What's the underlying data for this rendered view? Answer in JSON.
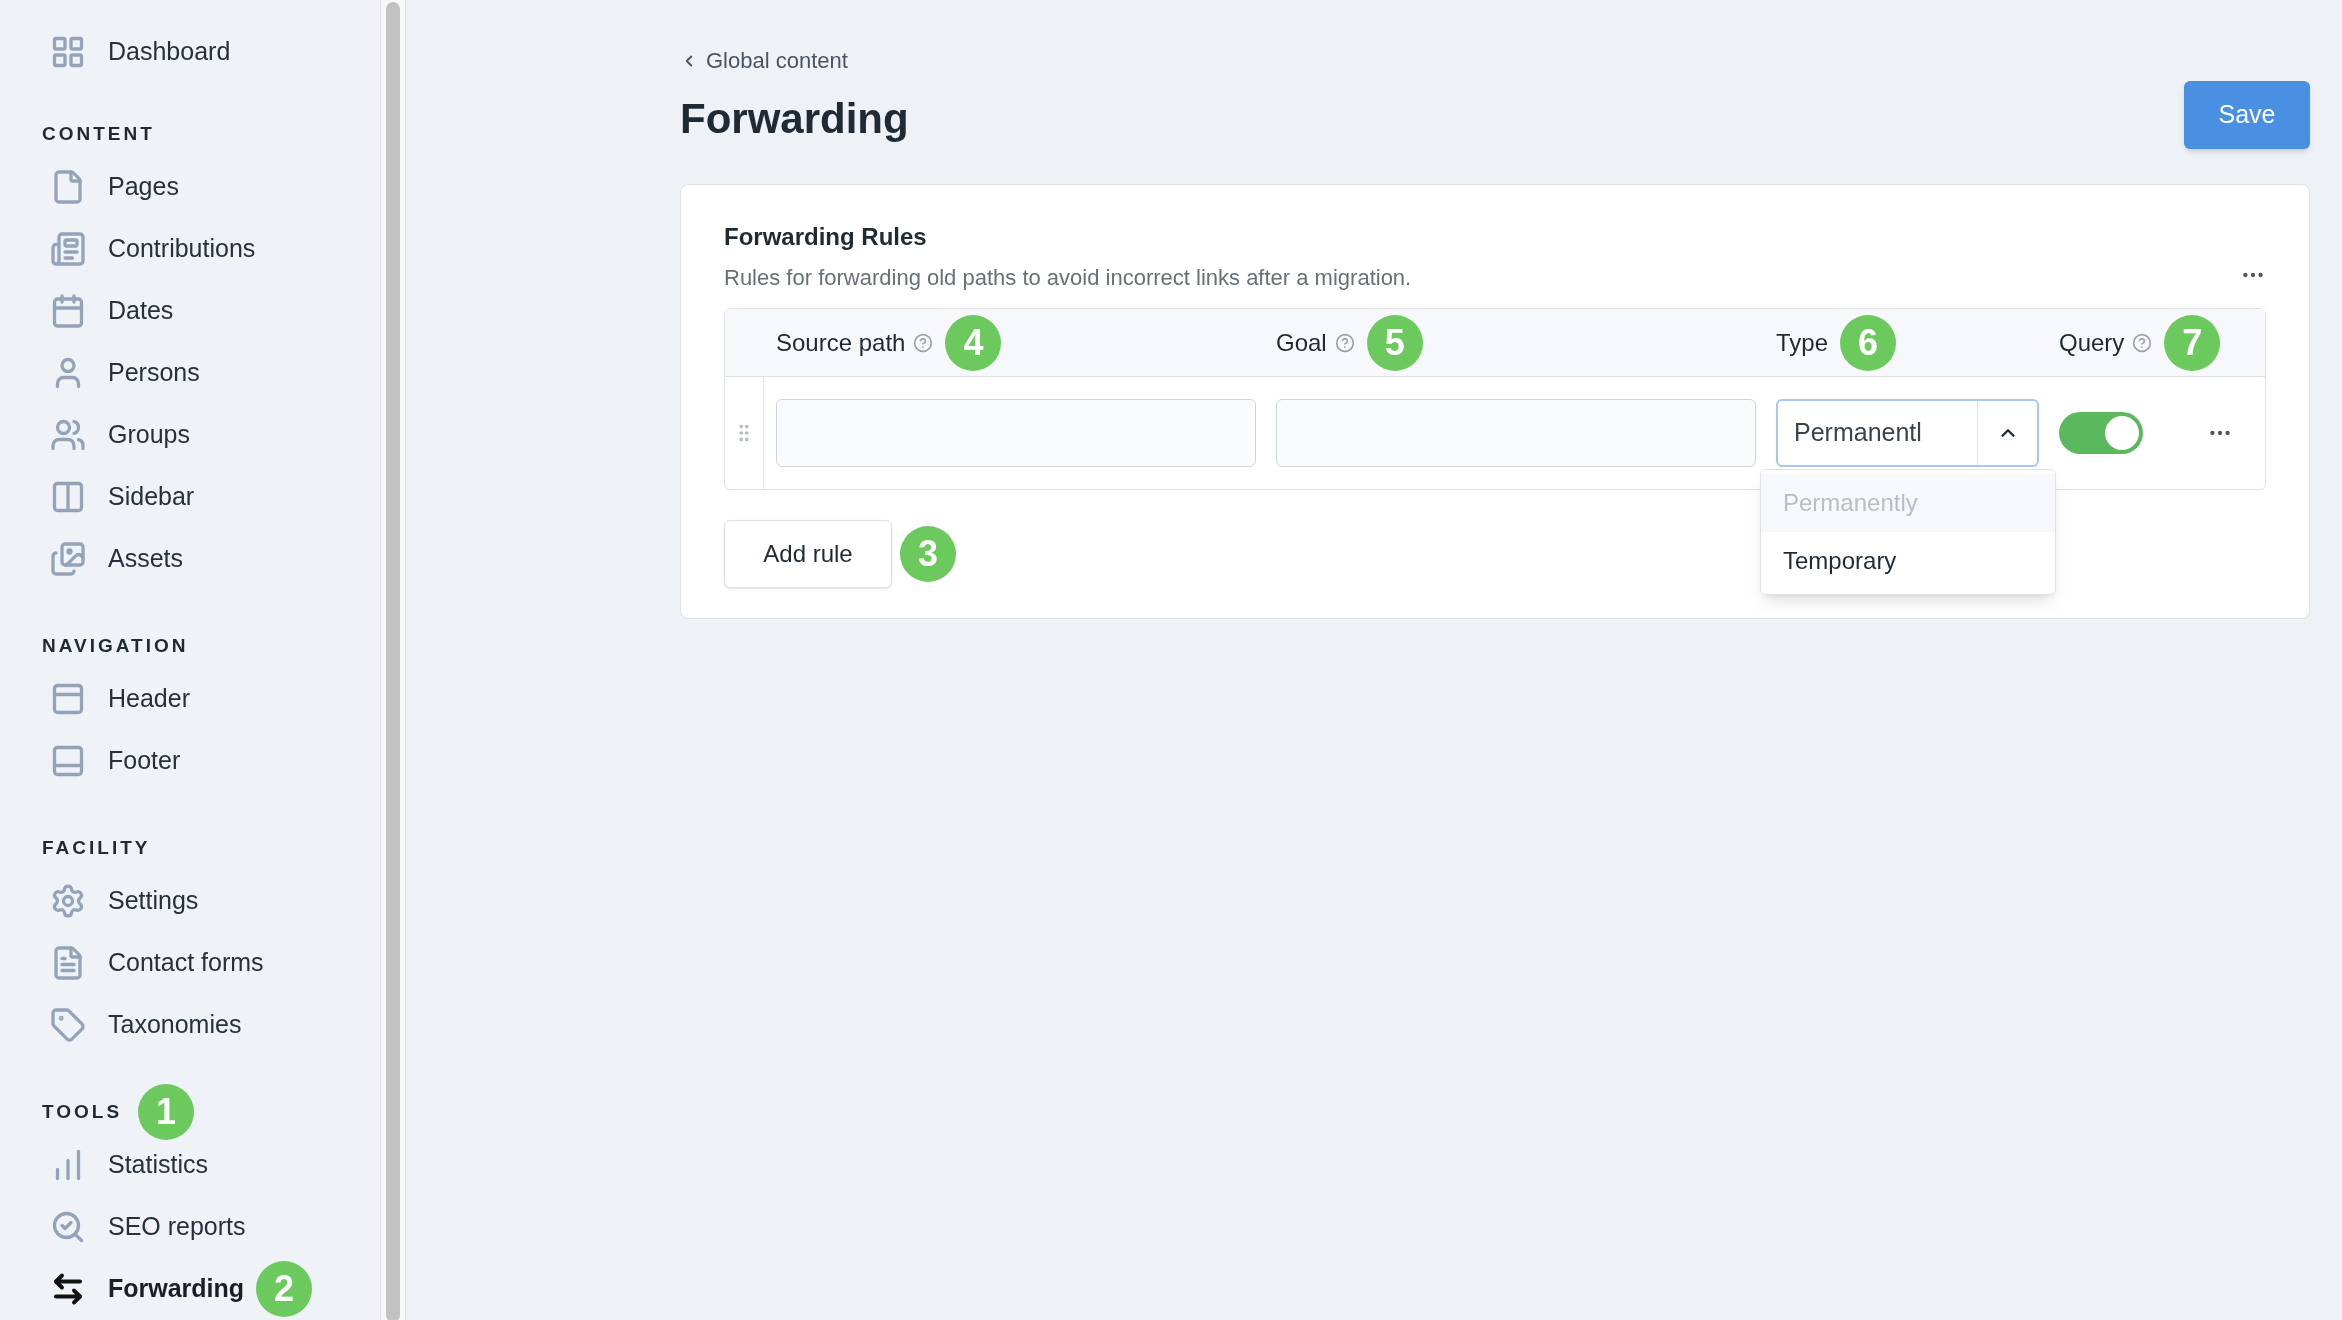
{
  "sidebar": {
    "top_item": {
      "label": "Dashboard",
      "selected": false
    },
    "sections": [
      {
        "title": "CONTENT",
        "items": [
          {
            "label": "Pages",
            "selected": false
          },
          {
            "label": "Contributions",
            "selected": false
          },
          {
            "label": "Dates",
            "selected": false
          },
          {
            "label": "Persons",
            "selected": false
          },
          {
            "label": "Groups",
            "selected": false
          },
          {
            "label": "Sidebar",
            "selected": false
          },
          {
            "label": "Assets",
            "selected": false
          }
        ]
      },
      {
        "title": "NAVIGATION",
        "items": [
          {
            "label": "Header",
            "selected": false
          },
          {
            "label": "Footer",
            "selected": false
          }
        ]
      },
      {
        "title": "FACILITY",
        "items": [
          {
            "label": "Settings",
            "selected": false
          },
          {
            "label": "Contact forms",
            "selected": false
          },
          {
            "label": "Taxonomies",
            "selected": false
          }
        ]
      },
      {
        "title": "TOOLS",
        "badge": "1",
        "items": [
          {
            "label": "Statistics",
            "selected": false
          },
          {
            "label": "SEO reports",
            "selected": false
          },
          {
            "label": "Forwarding",
            "selected": true,
            "badge": "2"
          }
        ]
      }
    ]
  },
  "breadcrumb": "Global content",
  "title": "Forwarding",
  "save_button": "Save",
  "card": {
    "title": "Forwarding Rules",
    "description": "Rules for forwarding old paths to avoid incorrect links after a migration.",
    "columns": [
      {
        "label": "Source path",
        "help": true,
        "badge": "4"
      },
      {
        "label": "Goal",
        "help": true,
        "badge": "5"
      },
      {
        "label": "Type",
        "help": false,
        "badge": "6"
      },
      {
        "label": "Query",
        "help": true,
        "badge": "7"
      }
    ],
    "rows": [
      {
        "type_value": "Permanentl",
        "query_on": true,
        "type_expanded": true
      }
    ],
    "type_options": [
      {
        "label": "Permanently",
        "selected": true
      },
      {
        "label": "Temporary",
        "selected": false
      }
    ],
    "add_button": {
      "label": "Add rule",
      "badge": "3"
    }
  }
}
